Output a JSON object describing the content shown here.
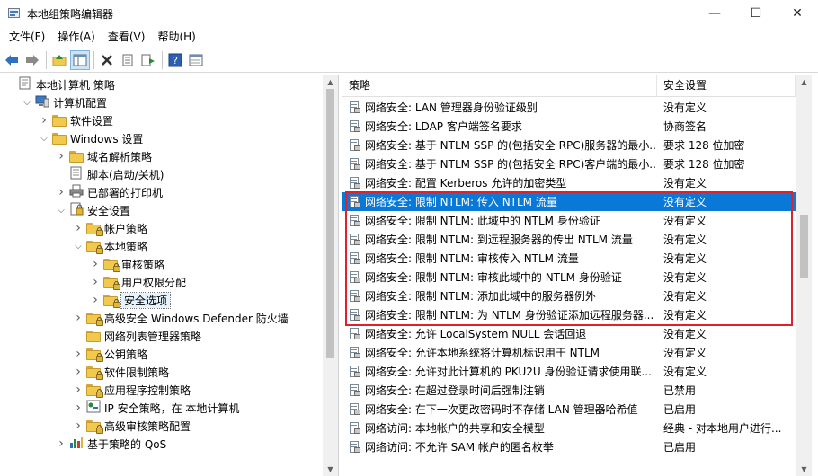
{
  "window": {
    "title": "本地组策略编辑器",
    "min_glyph": "—",
    "max_glyph": "☐",
    "close_glyph": "✕"
  },
  "menu": [
    {
      "label": "文件(F)"
    },
    {
      "label": "操作(A)"
    },
    {
      "label": "查看(V)"
    },
    {
      "label": "帮助(H)"
    }
  ],
  "toolbar": [
    "back-icon",
    "forward-icon",
    "up-folder-icon",
    "show-hide-tree-icon",
    "delete-icon",
    "properties-icon",
    "export-icon",
    "help-icon",
    "view-icon"
  ],
  "tree": {
    "items": [
      {
        "label": "本地计算机 策略",
        "icon": "computer-policy-icon",
        "level": 0,
        "twisty": ""
      },
      {
        "label": "计算机配置",
        "icon": "computer-config-icon",
        "level": 1,
        "twisty": "v"
      },
      {
        "label": "软件设置",
        "icon": "folder-icon",
        "level": 2,
        "twisty": ">"
      },
      {
        "label": "Windows 设置",
        "icon": "folder-icon",
        "level": 2,
        "twisty": "v"
      },
      {
        "label": "域名解析策略",
        "icon": "folder-icon",
        "level": 3,
        "twisty": ">"
      },
      {
        "label": "脚本(启动/关机)",
        "icon": "script-icon",
        "level": 3,
        "twisty": ""
      },
      {
        "label": "已部署的打印机",
        "icon": "printer-icon",
        "level": 3,
        "twisty": ">"
      },
      {
        "label": "安全设置",
        "icon": "security-icon",
        "level": 3,
        "twisty": "v"
      },
      {
        "label": "帐户策略",
        "icon": "lock-folder-icon",
        "level": 4,
        "twisty": ">"
      },
      {
        "label": "本地策略",
        "icon": "lock-folder-icon",
        "level": 4,
        "twisty": "v"
      },
      {
        "label": "审核策略",
        "icon": "lock-folder-icon",
        "level": 5,
        "twisty": ">"
      },
      {
        "label": "用户权限分配",
        "icon": "lock-folder-icon",
        "level": 5,
        "twisty": ">"
      },
      {
        "label": "安全选项",
        "icon": "lock-folder-icon",
        "level": 5,
        "twisty": ">",
        "selected": true
      },
      {
        "label": "高级安全 Windows Defender 防火墙",
        "icon": "lock-folder-icon",
        "level": 4,
        "twisty": ">"
      },
      {
        "label": "网络列表管理器策略",
        "icon": "folder-icon",
        "level": 4,
        "twisty": ""
      },
      {
        "label": "公钥策略",
        "icon": "lock-folder-icon",
        "level": 4,
        "twisty": ">"
      },
      {
        "label": "软件限制策略",
        "icon": "lock-folder-icon",
        "level": 4,
        "twisty": ">"
      },
      {
        "label": "应用程序控制策略",
        "icon": "lock-folder-icon",
        "level": 4,
        "twisty": ">"
      },
      {
        "label": "IP 安全策略，在 本地计算机",
        "icon": "ip-security-icon",
        "level": 4,
        "twisty": ">"
      },
      {
        "label": "高级审核策略配置",
        "icon": "lock-folder-icon",
        "level": 4,
        "twisty": ">"
      },
      {
        "label": "基于策略的 QoS",
        "icon": "qos-chart-icon",
        "level": 3,
        "twisty": ">"
      }
    ]
  },
  "list": {
    "columns": [
      "策略",
      "安全设置"
    ],
    "rows": [
      {
        "policy": "网络安全: LAN 管理器身份验证级别",
        "setting": "没有定义"
      },
      {
        "policy": "网络安全: LDAP 客户端签名要求",
        "setting": "协商签名"
      },
      {
        "policy": "网络安全: 基于 NTLM SSP 的(包括安全 RPC)服务器的最小...",
        "setting": "要求 128 位加密"
      },
      {
        "policy": "网络安全: 基于 NTLM SSP 的(包括安全 RPC)客户端的最小...",
        "setting": "要求 128 位加密"
      },
      {
        "policy": "网络安全: 配置 Kerberos 允许的加密类型",
        "setting": "没有定义"
      },
      {
        "policy": "网络安全: 限制 NTLM: 传入 NTLM 流量",
        "setting": "没有定义",
        "selected": true
      },
      {
        "policy": "网络安全: 限制 NTLM: 此域中的 NTLM 身份验证",
        "setting": "没有定义"
      },
      {
        "policy": "网络安全: 限制 NTLM: 到远程服务器的传出 NTLM 流量",
        "setting": "没有定义"
      },
      {
        "policy": "网络安全: 限制 NTLM: 审核传入 NTLM 流量",
        "setting": "没有定义"
      },
      {
        "policy": "网络安全: 限制 NTLM: 审核此域中的 NTLM 身份验证",
        "setting": "没有定义"
      },
      {
        "policy": "网络安全: 限制 NTLM: 添加此域中的服务器例外",
        "setting": "没有定义"
      },
      {
        "policy": "网络安全: 限制 NTLM: 为 NTLM 身份验证添加远程服务器...",
        "setting": "没有定义"
      },
      {
        "policy": "网络安全: 允许 LocalSystem NULL 会话回退",
        "setting": "没有定义"
      },
      {
        "policy": "网络安全: 允许本地系统将计算机标识用于 NTLM",
        "setting": "没有定义"
      },
      {
        "policy": "网络安全: 允许对此计算机的 PKU2U 身份验证请求使用联...",
        "setting": "没有定义"
      },
      {
        "policy": "网络安全: 在超过登录时间后强制注销",
        "setting": "已禁用"
      },
      {
        "policy": "网络安全: 在下一次更改密码时不存储 LAN 管理器哈希值",
        "setting": "已启用"
      },
      {
        "policy": "网络访问: 本地帐户的共享和安全模型",
        "setting": "经典 - 对本地用户进行..."
      },
      {
        "policy": "网络访问: 不允许 SAM 帐户的匿名枚举",
        "setting": "已启用"
      }
    ]
  },
  "colors": {
    "selection": "#0a78d7",
    "highlight_box": "#e0212b"
  }
}
